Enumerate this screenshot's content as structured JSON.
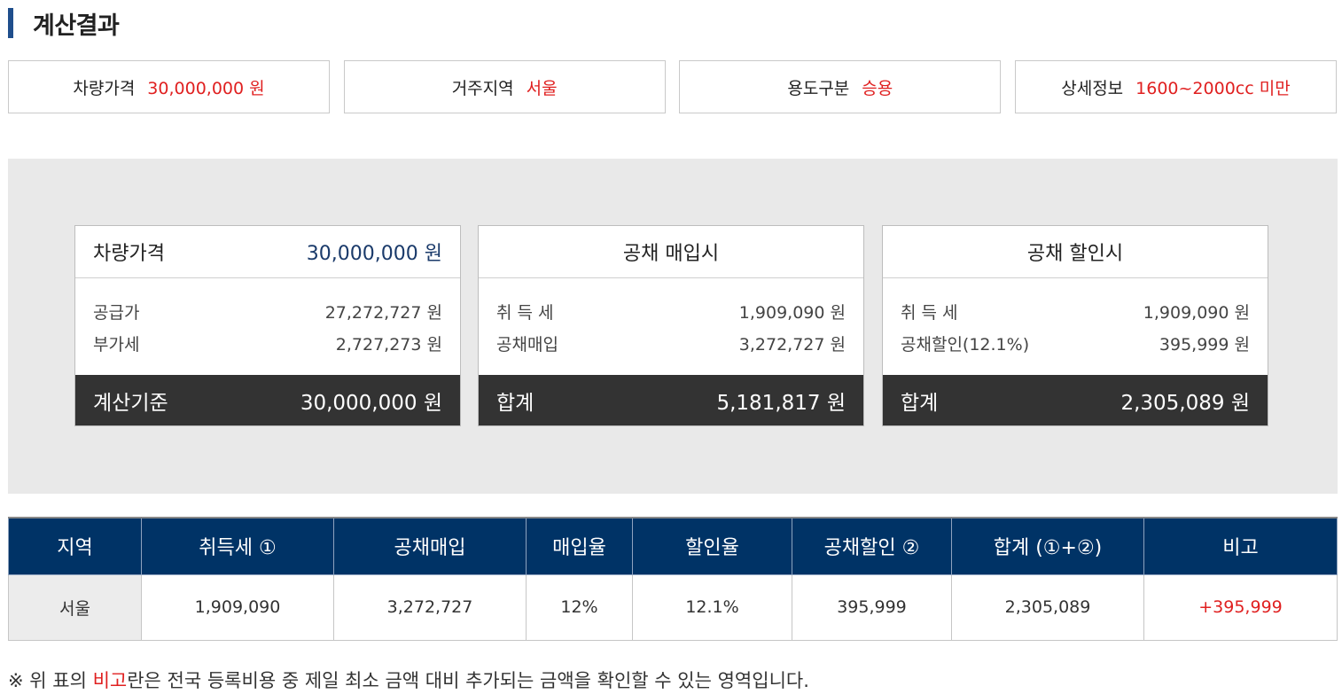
{
  "page_title": "계산결과",
  "summary": [
    {
      "label": "차량가격",
      "value": "30,000,000 원"
    },
    {
      "label": "거주지역",
      "value": "서울"
    },
    {
      "label": "용도구분",
      "value": "승용"
    },
    {
      "label": "상세정보",
      "value": "1600~2000cc 미만"
    }
  ],
  "card_price": {
    "head_label": "차량가격",
    "head_value": "30,000,000 원",
    "rows": [
      {
        "label": "공급가",
        "value": "27,272,727 원"
      },
      {
        "label": "부가세",
        "value": "2,727,273 원"
      }
    ],
    "foot_label": "계산기준",
    "foot_value": "30,000,000 원"
  },
  "card_purchase": {
    "head_label": "공채 매입시",
    "rows": [
      {
        "label": "취 득 세",
        "value": "1,909,090 원"
      },
      {
        "label": "공채매입",
        "value": "3,272,727 원"
      }
    ],
    "foot_label": "합계",
    "foot_value": "5,181,817 원"
  },
  "card_discount": {
    "head_label": "공채 할인시",
    "rows": [
      {
        "label": "취 득 세",
        "value": "1,909,090 원"
      },
      {
        "label": "공채할인(12.1%)",
        "value": "395,999 원"
      }
    ],
    "foot_label": "합계",
    "foot_value": "2,305,089 원"
  },
  "table": {
    "headers": [
      "지역",
      "취득세 ①",
      "공채매입",
      "매입율",
      "할인율",
      "공채할인 ②",
      "합계 (①+②)",
      "비고"
    ],
    "row": [
      "서울",
      "1,909,090",
      "3,272,727",
      "12%",
      "12.1%",
      "395,999",
      "2,305,089",
      "+395,999"
    ]
  },
  "note": {
    "prefix": "※ 위 표의 ",
    "highlight": "비고",
    "suffix": "란은 전국 등록비용 중 제일 최소 금액 대비 추가되는 금액을 확인할 수 있는 영역입니다."
  },
  "colors": {
    "accent": "#1f4e8c",
    "header_navy": "#003366",
    "highlight_red": "#e02020",
    "dark_footer": "#333333"
  }
}
